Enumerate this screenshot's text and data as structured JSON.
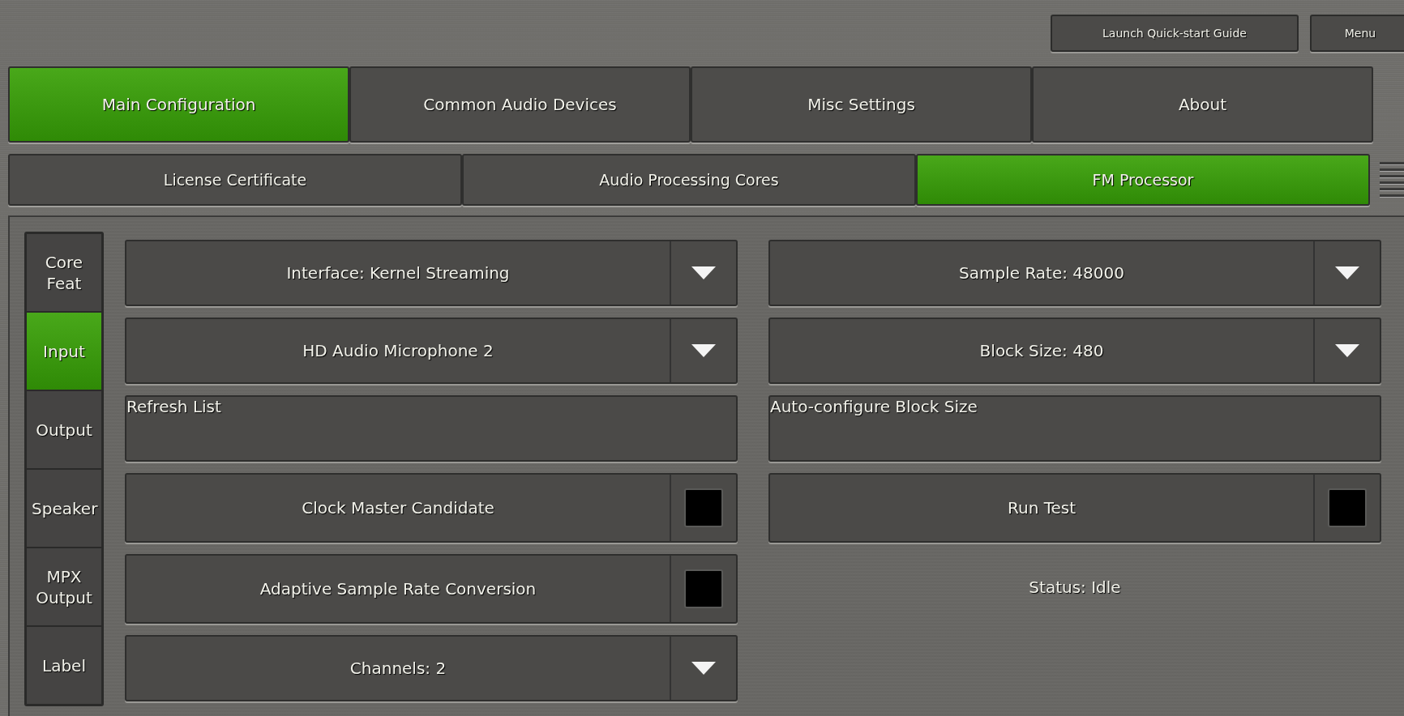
{
  "header_buttons": [
    "Launch Quick-start Guide",
    "Menu"
  ],
  "main_tabs": [
    {
      "label": "Main Configuration",
      "selected": true
    },
    {
      "label": "Common Audio Devices",
      "selected": false
    },
    {
      "label": "Misc Settings",
      "selected": false
    },
    {
      "label": "About",
      "selected": false
    }
  ],
  "sub_tabs": [
    {
      "label": "License Certificate",
      "selected": false
    },
    {
      "label": "Audio Processing Cores",
      "selected": false
    },
    {
      "label": "FM Processor",
      "selected": true
    }
  ],
  "side_tabs": [
    {
      "label": "Core Feat",
      "selected": false
    },
    {
      "label": "Input",
      "selected": true
    },
    {
      "label": "Output",
      "selected": false
    },
    {
      "label": "Speaker",
      "selected": false
    },
    {
      "label": "MPX Output",
      "selected": false
    },
    {
      "label": "Label",
      "selected": false
    }
  ],
  "left_controls": [
    {
      "kind": "dropdown",
      "label": "Interface: Kernel Streaming"
    },
    {
      "kind": "dropdown",
      "label": "HD Audio Microphone 2"
    },
    {
      "kind": "button",
      "label": "Refresh List"
    },
    {
      "kind": "checkbox",
      "label": "Clock Master Candidate",
      "checked": false
    },
    {
      "kind": "checkbox",
      "label": "Adaptive Sample Rate Conversion",
      "checked": false
    },
    {
      "kind": "dropdown",
      "label": "Channels: 2"
    }
  ],
  "right_controls": [
    {
      "kind": "dropdown",
      "label": "Sample Rate: 48000"
    },
    {
      "kind": "dropdown",
      "label": "Block Size: 480"
    },
    {
      "kind": "button",
      "label": "Auto-configure Block Size"
    },
    {
      "kind": "checkbox",
      "label": "Run Test",
      "checked": false
    },
    {
      "kind": "status",
      "label": "Status: Idle"
    }
  ]
}
